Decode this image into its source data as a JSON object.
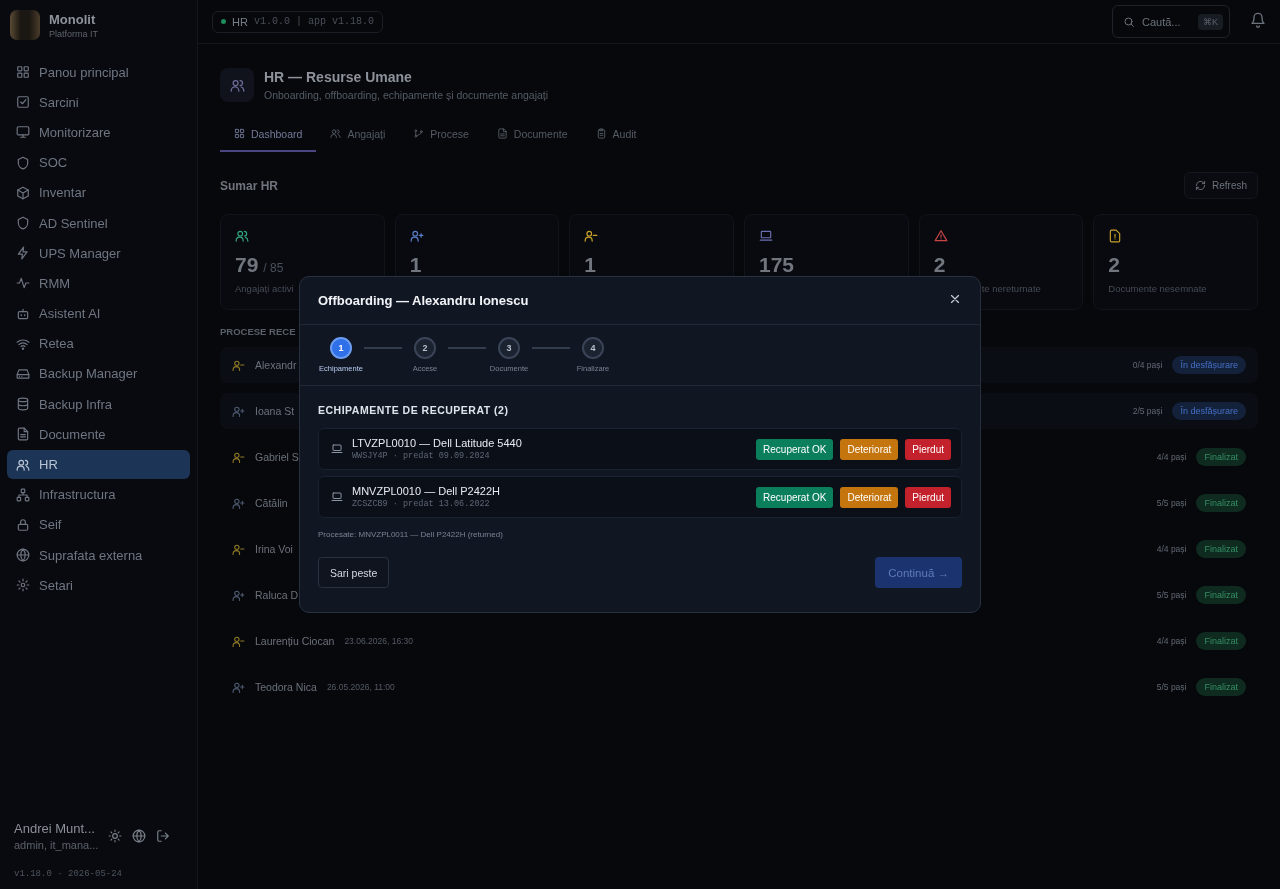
{
  "brand": {
    "name": "Monolit",
    "subtitle": "Platforma IT"
  },
  "sidebar": {
    "items": [
      {
        "label": "Panou principal",
        "selected": false
      },
      {
        "label": "Sarcini",
        "selected": false
      },
      {
        "label": "Monitorizare",
        "selected": false
      },
      {
        "label": "SOC",
        "selected": false
      },
      {
        "label": "Inventar",
        "selected": false
      },
      {
        "label": "AD Sentinel",
        "selected": false
      },
      {
        "label": "UPS Manager",
        "selected": false
      },
      {
        "label": "RMM",
        "selected": false
      },
      {
        "label": "Asistent AI",
        "selected": false
      },
      {
        "label": "Retea",
        "selected": false
      },
      {
        "label": "Backup Manager",
        "selected": false
      },
      {
        "label": "Backup Infra",
        "selected": false
      },
      {
        "label": "Documente",
        "selected": false
      },
      {
        "label": "HR",
        "selected": true
      },
      {
        "label": "Infrastructura",
        "selected": false
      },
      {
        "label": "Seif",
        "selected": false
      },
      {
        "label": "Suprafata externa",
        "selected": false
      },
      {
        "label": "Setari",
        "selected": false
      }
    ],
    "user": {
      "name": "Andrei Munt...",
      "role": "admin, it_mana..."
    },
    "version": "v1.18.0 · 2026-05-24"
  },
  "topbar": {
    "module": "HR",
    "module_version": "v1.0.0",
    "separator": "|",
    "app_version": "app v1.18.0",
    "search": {
      "placeholder": "Caută...",
      "shortcut": "⌘K"
    }
  },
  "header": {
    "title": "HR — Resurse Umane",
    "subtitle": "Onboarding, offboarding, echipamente și documente angajați"
  },
  "tabs": [
    {
      "label": "Dashboard",
      "selected": true
    },
    {
      "label": "Angajați",
      "selected": false
    },
    {
      "label": "Procese",
      "selected": false
    },
    {
      "label": "Documente",
      "selected": false
    },
    {
      "label": "Audit",
      "selected": false
    }
  ],
  "summary": {
    "title": "Sumar HR",
    "refresh": "Refresh",
    "cards": [
      {
        "kind": "employees",
        "value": "79",
        "total": "/ 85",
        "label": "Angajați activi"
      },
      {
        "kind": "onboarding",
        "value": "1"
      },
      {
        "kind": "offboarding",
        "value": "1"
      },
      {
        "kind": "equipment",
        "value": "175"
      },
      {
        "kind": "warning",
        "value": "2",
        "label": "te nereturnate"
      },
      {
        "kind": "document",
        "value": "2",
        "label": "Documente nesemnate"
      }
    ]
  },
  "processes": {
    "title": "PROCESE RECE",
    "rows": [
      {
        "kind": "offboarding",
        "name": "Alexandr",
        "steps": "0/4 pași",
        "status": {
          "label": "În desfășurare",
          "color": "#14213a"
        }
      },
      {
        "kind": "onboarding",
        "name": "Ioana St",
        "steps": "2/5 pași",
        "status": {
          "label": "În desfășurare",
          "color": "#14213a"
        }
      },
      {
        "kind": "offboarding",
        "name": "Gabriel S",
        "steps": "4/4 pași",
        "status": {
          "label": "Finalizat",
          "color": "#0f2a1e"
        }
      },
      {
        "kind": "onboarding",
        "name": "Cătălin",
        "steps": "5/5 pași",
        "status": {
          "label": "Finalizat",
          "color": "#0f2a1e"
        }
      },
      {
        "kind": "offboarding",
        "name": "Irina Voi",
        "steps": "4/4 pași",
        "status": {
          "label": "Finalizat",
          "color": "#0f2a1e"
        }
      },
      {
        "kind": "onboarding",
        "name": "Raluca D",
        "steps": "5/5 pași",
        "status": {
          "label": "Finalizat",
          "color": "#0f2a1e"
        }
      },
      {
        "kind": "offboarding",
        "name": "Laurențiu Ciocan",
        "date": "23.06.2026, 16:30",
        "steps": "4/4 pași",
        "status": {
          "label": "Finalizat",
          "color": "#0f2a1e"
        }
      },
      {
        "kind": "onboarding",
        "name": "Teodora Nica",
        "date": "26.05.2026, 11:00",
        "steps": "5/5 pași",
        "status": {
          "label": "Finalizat",
          "color": "#0f2a1e"
        }
      }
    ]
  },
  "modal": {
    "title": "Offboarding — Alexandru Ionescu",
    "steps": [
      {
        "number": "1",
        "label": "Echipamente",
        "selected": true
      },
      {
        "number": "2",
        "label": "Accese",
        "selected": false
      },
      {
        "number": "3",
        "label": "Documente",
        "selected": false
      },
      {
        "number": "4",
        "label": "Finalizare",
        "selected": false
      }
    ],
    "section_title": "ECHIPAMENTE DE RECUPERAT (2)",
    "items": [
      {
        "title": "LTVZPL0010 — Dell Latitude 5440",
        "serial": "WWSJY4P",
        "separator": "·",
        "handed": "predat 09.09.2024",
        "actions": [
          {
            "label": "Recuperat OK",
            "kind": "ok"
          },
          {
            "label": "Deteriorat",
            "kind": "damaged"
          },
          {
            "label": "Pierdut",
            "kind": "lost"
          }
        ]
      },
      {
        "title": "MNVZPL0010 — Dell P2422H",
        "serial": "ZCSZCB9",
        "separator": "·",
        "handed": "predat 13.06.2022",
        "actions": [
          {
            "label": "Recuperat OK",
            "kind": "ok"
          },
          {
            "label": "Deteriorat",
            "kind": "damaged"
          },
          {
            "label": "Pierdut",
            "kind": "lost"
          }
        ]
      }
    ],
    "processed": "Procesate: MNVZPL0011 — Dell P2422H (returned)",
    "skip": "Sari peste",
    "continue": {
      "label": "Continuă →",
      "disabled": true
    }
  }
}
